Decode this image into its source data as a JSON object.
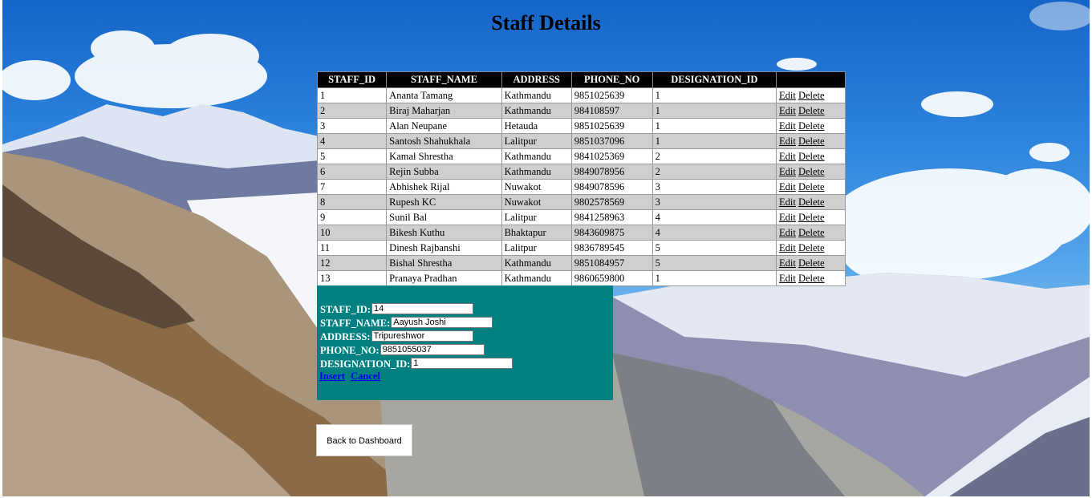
{
  "page": {
    "title": "Staff Details"
  },
  "table": {
    "headers": [
      "STAFF_ID",
      "STAFF_NAME",
      "ADDRESS",
      "PHONE_NO",
      "DESIGNATION_ID",
      ""
    ],
    "edit_label": "Edit",
    "delete_label": "Delete",
    "rows": [
      {
        "id": "1",
        "name": "Ananta Tamang",
        "address": "Kathmandu",
        "phone": "9851025639",
        "designation": "1"
      },
      {
        "id": "2",
        "name": "Biraj Maharjan",
        "address": "Kathmandu",
        "phone": "984108597",
        "designation": "1"
      },
      {
        "id": "3",
        "name": "Alan Neupane",
        "address": "Hetauda",
        "phone": "9851025639",
        "designation": "1"
      },
      {
        "id": "4",
        "name": "Santosh Shahukhala",
        "address": "Lalitpur",
        "phone": "9851037096",
        "designation": "1"
      },
      {
        "id": "5",
        "name": "Kamal Shrestha",
        "address": "Kathmandu",
        "phone": "9841025369",
        "designation": "2"
      },
      {
        "id": "6",
        "name": "Rejin Subba",
        "address": "Kathmandu",
        "phone": "9849078956",
        "designation": "2"
      },
      {
        "id": "7",
        "name": "Abhishek Rijal",
        "address": "Nuwakot",
        "phone": "9849078596",
        "designation": "3"
      },
      {
        "id": "8",
        "name": "Rupesh KC",
        "address": "Nuwakot",
        "phone": "9802578569",
        "designation": "3"
      },
      {
        "id": "9",
        "name": "Sunil Bal",
        "address": "Lalitpur",
        "phone": "9841258963",
        "designation": "4"
      },
      {
        "id": "10",
        "name": "Bikesh Kuthu",
        "address": "Bhaktapur",
        "phone": "9843609875",
        "designation": "4"
      },
      {
        "id": "11",
        "name": "Dinesh Rajbanshi",
        "address": "Lalitpur",
        "phone": "9836789545",
        "designation": "5"
      },
      {
        "id": "12",
        "name": "Bishal Shrestha",
        "address": "Kathmandu",
        "phone": "9851084957",
        "designation": "5"
      },
      {
        "id": "13",
        "name": "Pranaya Pradhan",
        "address": "Kathmandu",
        "phone": "9860659800",
        "designation": "1"
      }
    ]
  },
  "form": {
    "staff_id_label": "STAFF_ID:",
    "staff_id_value": "14",
    "staff_name_label": "STAFF_NAME:",
    "staff_name_value": "Aayush Joshi",
    "address_label": "ADDRESS:",
    "address_value": "Tripureshwor",
    "phone_label": "PHONE_NO:",
    "phone_value": "9851055037",
    "designation_label": "DESIGNATION_ID:",
    "designation_value": "1",
    "insert_label": "Insert",
    "cancel_label": "Cancel"
  },
  "back_button": {
    "label": "Back to Dashboard"
  },
  "colors": {
    "form_bg": "#008080",
    "header_bg": "#000000",
    "even_row": "#cfcfcf",
    "link": "#0000ee"
  }
}
